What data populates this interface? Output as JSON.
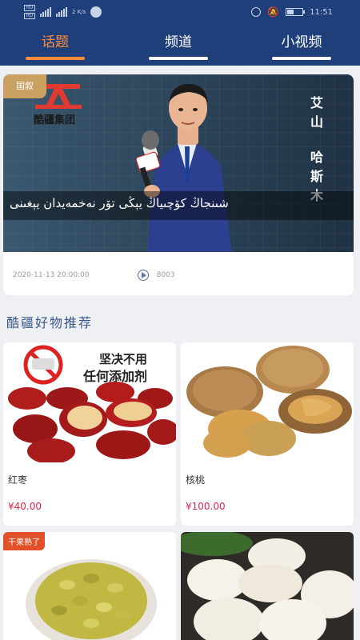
{
  "status_bar": {
    "sim1": "HD",
    "sim2": "HD",
    "net_speed": "2 K/s",
    "time": "11:51"
  },
  "tabs": [
    {
      "label": "话题",
      "active": true
    },
    {
      "label": "频道",
      "active": false
    },
    {
      "label": "小视频",
      "active": false
    }
  ],
  "news": {
    "badge": "国叙",
    "brand_name": "酷疆集团",
    "vertical_title": [
      "艾",
      "山",
      "哈",
      "斯",
      "木"
    ],
    "caption": "شىنجاڭ كۆچىياڭ يېڭى تۆر نەخمەيدان يېغىنى",
    "date": "2020-11-13 20:00:00",
    "play_count": "8003"
  },
  "section_title": "酷疆好物推荐",
  "products": [
    {
      "name": "红枣",
      "price": "¥40.00",
      "tag": ""
    },
    {
      "name": "核桃",
      "price": "¥100.00",
      "tag": ""
    },
    {
      "name": "",
      "price": "",
      "tag": "干果熟了"
    },
    {
      "name": "",
      "price": "",
      "tag": ""
    }
  ],
  "product_image_text": {
    "banner": "坚决不用\n任何添加剂"
  },
  "colors": {
    "header_bg": "#1f3f7a",
    "active_tab": "#ff8c3a",
    "price": "#e0264a",
    "badge": "#c9a161"
  }
}
